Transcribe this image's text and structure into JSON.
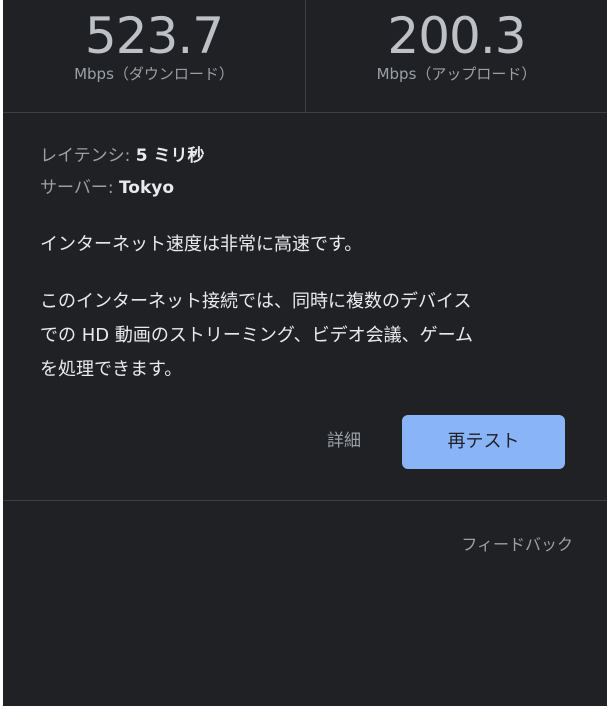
{
  "speeds": {
    "download": {
      "value": "523.7",
      "unit": "Mbps（ダウンロード）"
    },
    "upload": {
      "value": "200.3",
      "unit": "Mbps（アップロード）"
    }
  },
  "info": {
    "latency_label": "レイテンシ: ",
    "latency_value": "5 ミリ秒",
    "server_label": "サーバー: ",
    "server_value": "Tokyo"
  },
  "summary": "インターネット速度は非常に高速です。",
  "description_lines": [
    "このインターネット接続では、同時に複数のデバイス",
    "での HD 動画のストリーミング、ビデオ会議、ゲーム",
    "を処理できます。"
  ],
  "actions": {
    "details_label": "詳細",
    "retest_label": "再テスト"
  },
  "footer": {
    "feedback_label": "フィードバック"
  },
  "colors": {
    "background": "#202124",
    "accent_button": "#8ab4f8",
    "primary_text": "#e8eaed",
    "secondary_text": "#9aa0a6"
  }
}
